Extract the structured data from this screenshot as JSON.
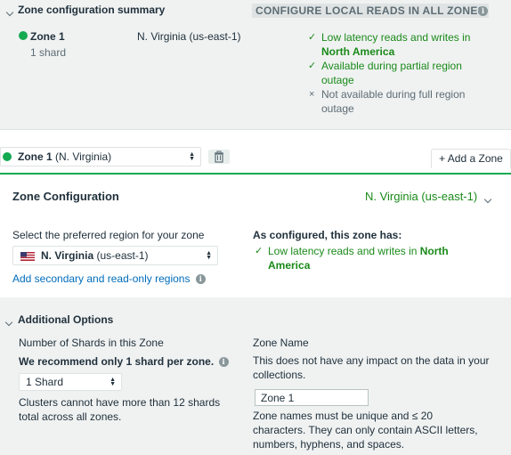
{
  "summary": {
    "title": "Zone configuration summary",
    "action_label": "CONFIGURE LOCAL READS IN ALL ZONES",
    "zone_name": "Zone 1",
    "zone_shards": "1 shard",
    "zone_region": "N. Virginia (us-east-1)",
    "features": [
      {
        "icon": "check",
        "text_a": "Low latency reads and writes in",
        "text_b": "North America"
      },
      {
        "icon": "check",
        "text_a": "Available during partial region",
        "text_b": "outage"
      },
      {
        "icon": "x",
        "text_a": "Not available during full region",
        "text_b": "outage"
      }
    ]
  },
  "zone_bar": {
    "selected_zone": "Zone 1",
    "selected_zone_region": "(N. Virginia)",
    "add_zone_label": "+ Add a Zone"
  },
  "zone_config": {
    "title": "Zone Configuration",
    "region_summary": "N. Virginia (us-east-1)",
    "region_prompt": "Select the preferred region for your zone",
    "region_select_bold": "N. Virginia",
    "region_select_rest": "(us-east-1)",
    "add_regions_link": "Add secondary and read-only regions",
    "configured_title": "As configured, this zone has:",
    "configured_line_a": "Low latency reads and writes in",
    "configured_line_a_bold": "North",
    "configured_line_b_bold": "America"
  },
  "additional": {
    "title": "Additional Options",
    "shards_label": "Number of Shards in this Zone",
    "shards_recommend": "We recommend only 1 shard per zone.",
    "shards_value": "1 Shard",
    "shards_note_a": "Clusters cannot have more than 12 shards",
    "shards_note_b": "total across all zones.",
    "zone_name_label": "Zone Name",
    "zone_name_help_a": "This does not have any impact on the data in your",
    "zone_name_help_b": "collections.",
    "zone_name_value": "Zone 1",
    "zone_name_rules_a": "Zone names must be unique and ≤ 20",
    "zone_name_rules_b": "characters. They can only contain ASCII letters,",
    "zone_name_rules_c": "numbers, hyphens, and spaces."
  },
  "colors": {
    "accent_green": "#13aa52",
    "text_green": "#1a8a1a",
    "link_blue": "#006cbc",
    "panel_grey": "#f0f2f2"
  }
}
